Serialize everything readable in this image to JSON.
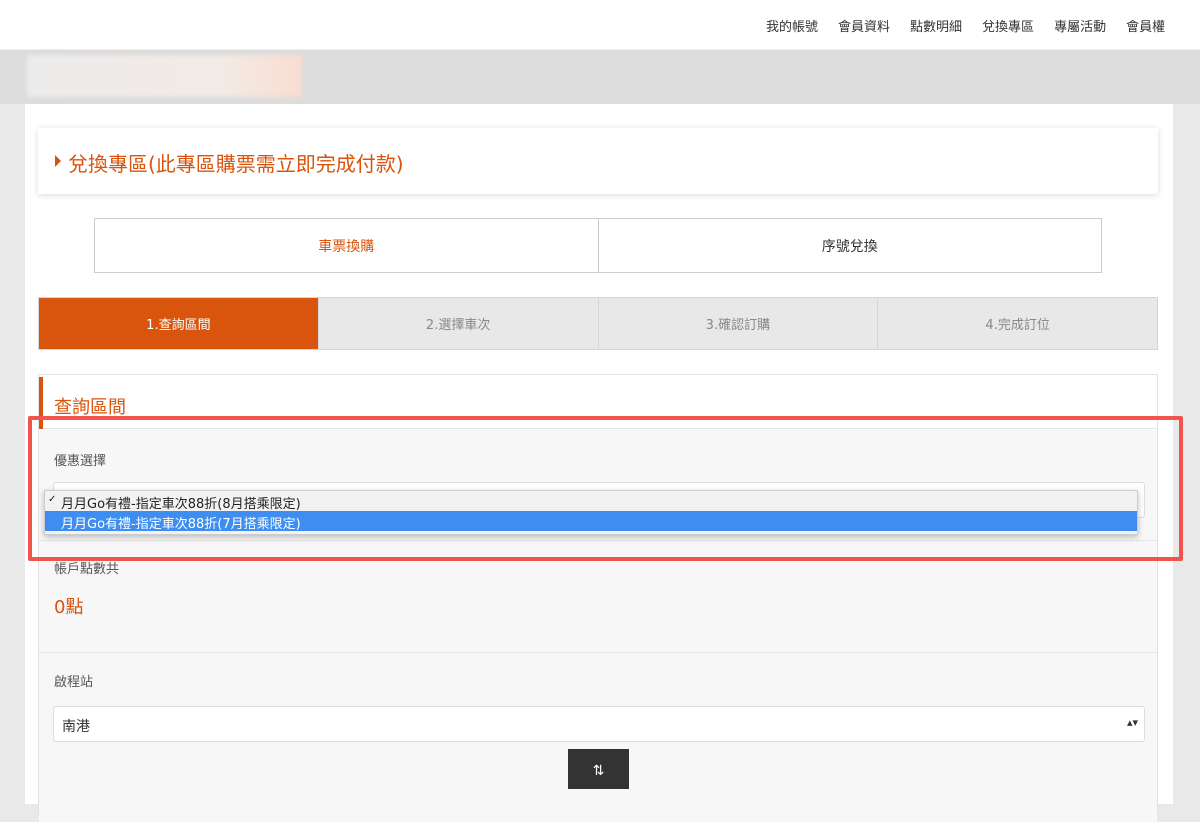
{
  "topnav": {
    "links": [
      "我的帳號",
      "會員資料",
      "點數明細",
      "兌換專區",
      "專屬活動",
      "會員權"
    ]
  },
  "page_title": "兌換專區(此專區購票需立即完成付款)",
  "tabs": [
    {
      "label": "車票換購",
      "active": true
    },
    {
      "label": "序號兌換",
      "active": false
    }
  ],
  "steps": [
    {
      "label": "1.查詢區間",
      "active": true
    },
    {
      "label": "2.選擇車次"
    },
    {
      "label": "3.確認訂購"
    },
    {
      "label": "4.完成訂位"
    }
  ],
  "section": {
    "title": "查詢區間",
    "discount": {
      "label": "優惠選擇",
      "options": [
        {
          "label": "月月Go有禮-指定車次88折(8月搭乘限定)",
          "selected": true
        },
        {
          "label": "月月Go有禮-指定車次88折(7月搭乘限定)",
          "highlighted": true
        }
      ]
    },
    "points": {
      "label": "帳戶點數共",
      "value": "0點"
    },
    "departure": {
      "label": "啟程站",
      "value": "南港"
    },
    "swap_icon": "swap-vertical-icon"
  },
  "colors": {
    "accent": "#d9540c",
    "highlight": "#3d8ef0",
    "annotation": "#f0544c"
  }
}
